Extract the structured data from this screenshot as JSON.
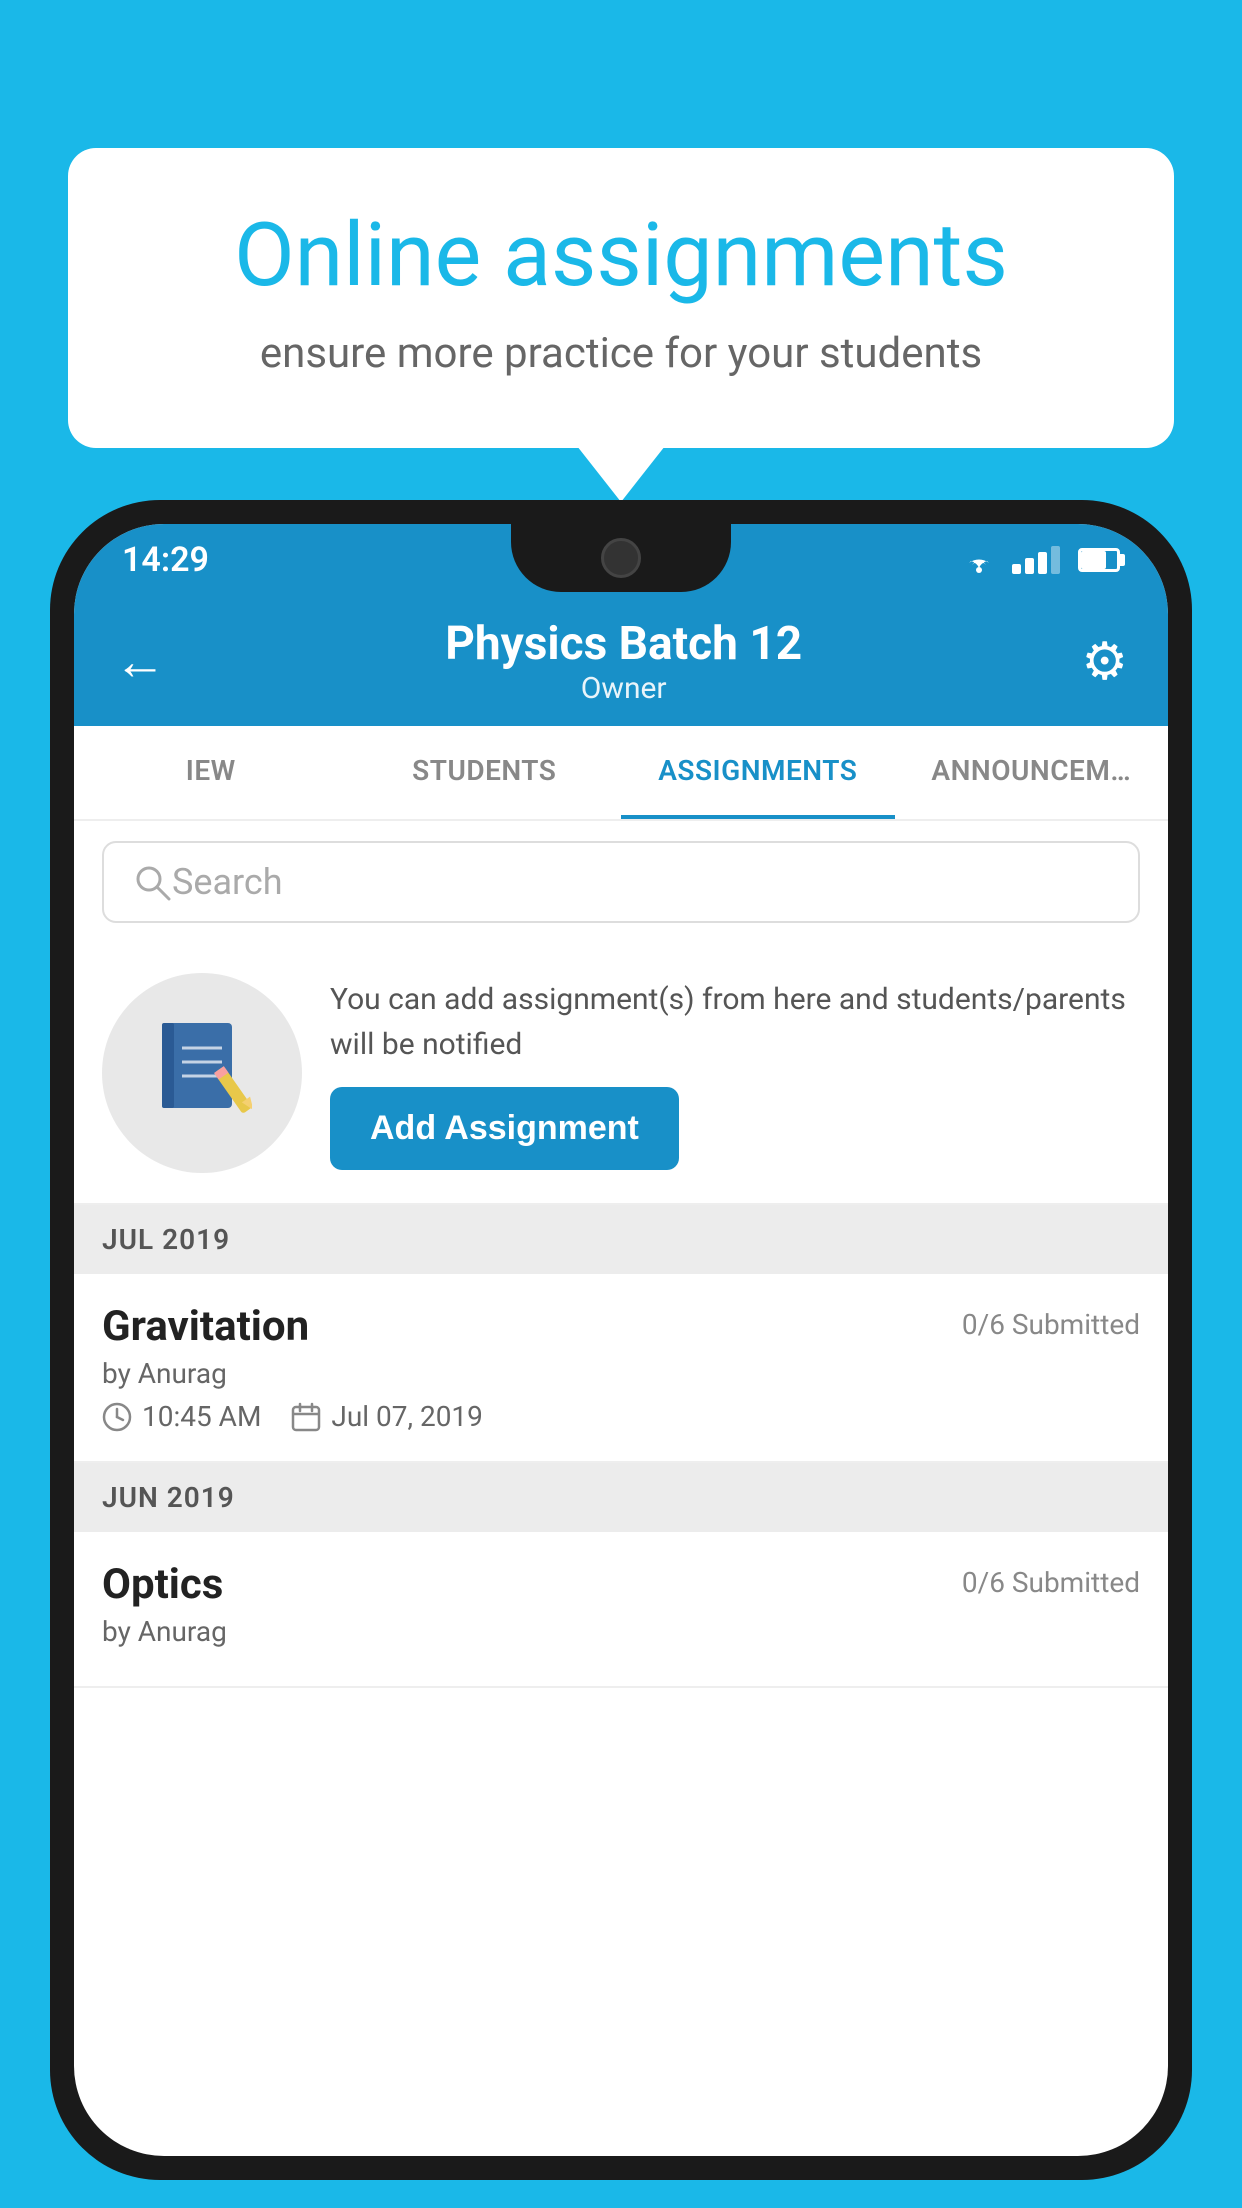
{
  "background_color": "#1ab8e8",
  "tooltip": {
    "title": "Online assignments",
    "subtitle": "ensure more practice for your students"
  },
  "phone": {
    "status_bar": {
      "time": "14:29",
      "wifi": "▼",
      "battery_percent": 70
    },
    "header": {
      "title": "Physics Batch 12",
      "subtitle": "Owner",
      "back_label": "←",
      "settings_label": "⚙"
    },
    "tabs": [
      {
        "label": "IEW",
        "active": false
      },
      {
        "label": "STUDENTS",
        "active": false
      },
      {
        "label": "ASSIGNMENTS",
        "active": true
      },
      {
        "label": "ANNOUNCEM…",
        "active": false
      }
    ],
    "search": {
      "placeholder": "Search"
    },
    "promo": {
      "icon": "📓",
      "text": "You can add assignment(s) from here and students/parents will be notified",
      "button_label": "Add Assignment"
    },
    "sections": [
      {
        "month_label": "JUL 2019",
        "assignments": [
          {
            "name": "Gravitation",
            "submitted": "0/6 Submitted",
            "author": "by Anurag",
            "time": "10:45 AM",
            "date": "Jul 07, 2019"
          }
        ]
      },
      {
        "month_label": "JUN 2019",
        "assignments": [
          {
            "name": "Optics",
            "submitted": "0/6 Submitted",
            "author": "by Anurag",
            "time": "",
            "date": ""
          }
        ]
      }
    ]
  }
}
